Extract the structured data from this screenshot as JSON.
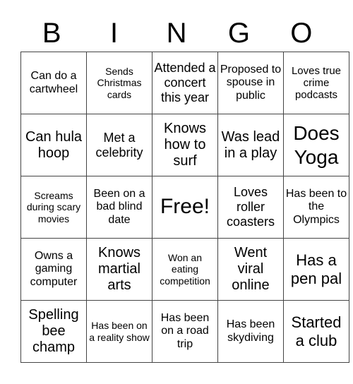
{
  "header": {
    "letters": [
      "B",
      "I",
      "N",
      "G",
      "O"
    ]
  },
  "board": {
    "rows": [
      [
        "Can do a cartwheel",
        "Sends Christmas cards",
        "Attended a concert this year",
        "Proposed to spouse in public",
        "Loves true crime podcasts"
      ],
      [
        "Can hula hoop",
        "Met a celebrity",
        "Knows how to surf",
        "Was lead in a play",
        "Does Yoga"
      ],
      [
        "Screams during scary movies",
        "Been on a bad blind date",
        "Free!",
        "Loves roller coasters",
        "Has been to the Olympics"
      ],
      [
        "Owns a gaming computer",
        "Knows martial arts",
        "Won an eating competition",
        "Went viral online",
        "Has a pen pal"
      ],
      [
        "Spelling bee champ",
        "Has been on a reality show",
        "Has been on a road trip",
        "Has been skydiving",
        "Started a club"
      ]
    ]
  }
}
